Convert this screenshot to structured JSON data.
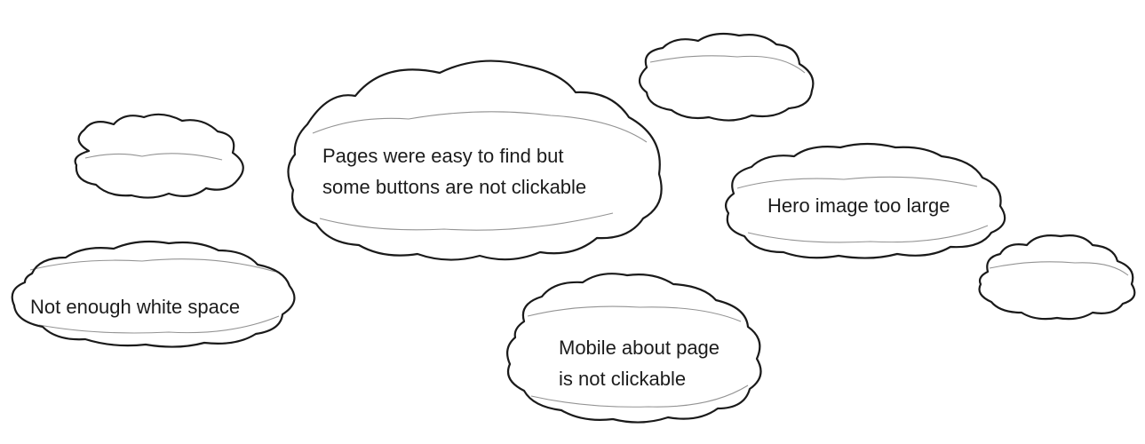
{
  "clouds": [
    {
      "id": "cloud-small-top-left",
      "lines": []
    },
    {
      "id": "cloud-pages-easy",
      "lines": [
        "Pages were easy to find but",
        "some buttons are not clickable"
      ]
    },
    {
      "id": "cloud-small-top-right",
      "lines": []
    },
    {
      "id": "cloud-hero-image",
      "lines": [
        "Hero image too large"
      ]
    },
    {
      "id": "cloud-small-right",
      "lines": []
    },
    {
      "id": "cloud-white-space",
      "lines": [
        "Not enough white space"
      ]
    },
    {
      "id": "cloud-mobile-about",
      "lines": [
        "Mobile about page",
        "is not clickable"
      ]
    }
  ]
}
